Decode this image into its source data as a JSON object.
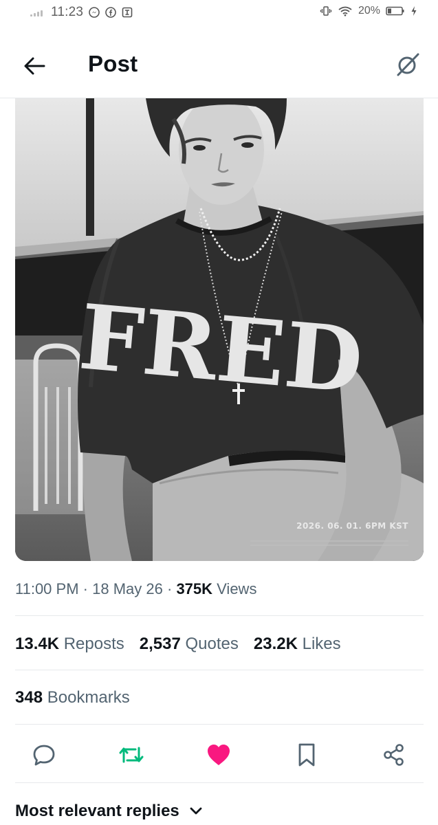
{
  "status_bar": {
    "time": "11:23",
    "battery": "20%",
    "left_icons": [
      "messenger-icon",
      "facebook-icon",
      "threads-icon"
    ],
    "right_icons": [
      "vibrate-icon",
      "wifi-icon",
      "battery-icon",
      "charging-icon"
    ]
  },
  "header": {
    "title": "Post",
    "back_icon": "back-arrow-icon",
    "grok_icon": "grok-icon"
  },
  "media": {
    "shirt_text": "FRED",
    "overlay_date": "2026. 06. 01. 6PM KST"
  },
  "meta": {
    "time": "11:00 PM",
    "separator": "·",
    "date": "18 May 26",
    "views_count": "375K",
    "views_label": "Views"
  },
  "stats": {
    "reposts_count": "13.4K",
    "reposts_label": "Reposts",
    "quotes_count": "2,537",
    "quotes_label": "Quotes",
    "likes_count": "23.2K",
    "likes_label": "Likes",
    "bookmarks_count": "348",
    "bookmarks_label": "Bookmarks"
  },
  "actions": {
    "icons": [
      "reply-icon",
      "repost-icon",
      "like-icon",
      "bookmark-icon",
      "share-icon"
    ],
    "repost_color": "#00ba7c",
    "like_color": "#f91880",
    "default_color": "#536471"
  },
  "replies": {
    "sort_label": "Most relevant replies"
  }
}
